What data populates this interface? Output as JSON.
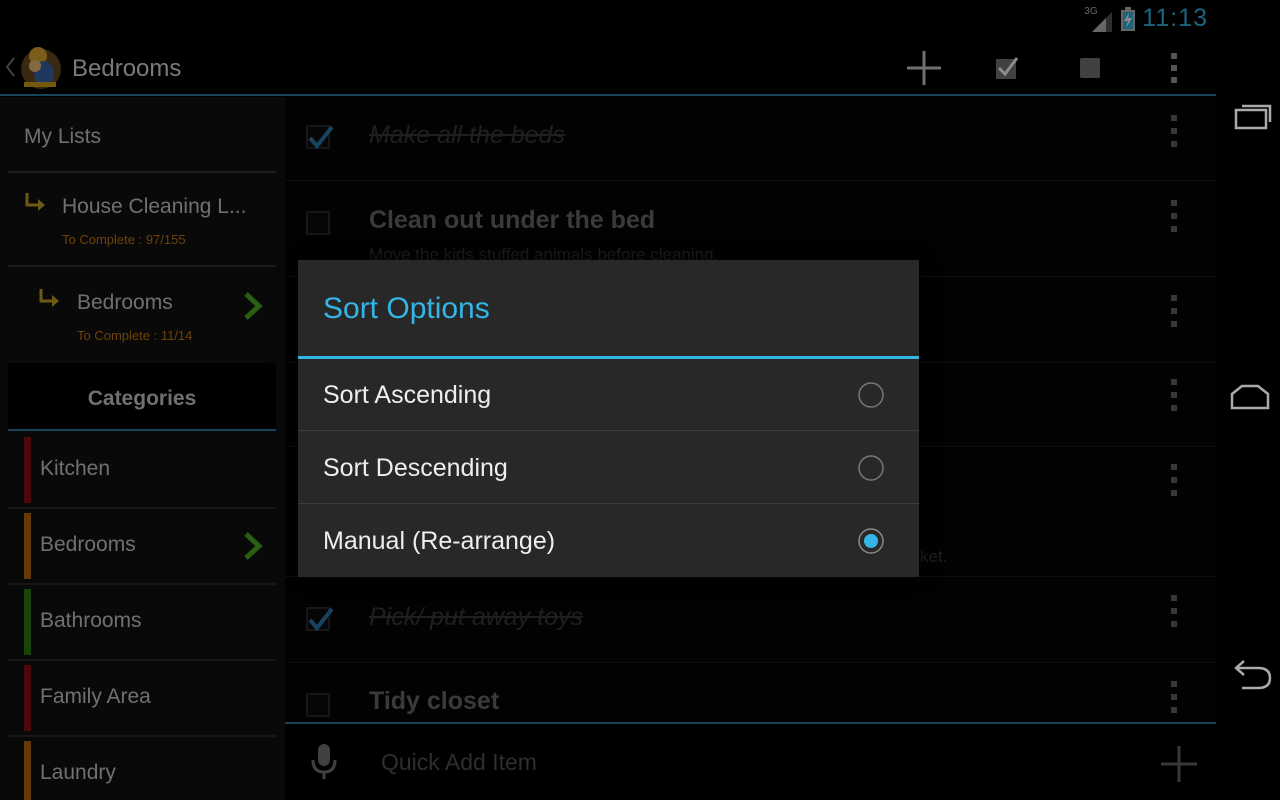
{
  "status_bar": {
    "network": "3G",
    "time": "11:13",
    "accent": "#33b5e5"
  },
  "action_bar": {
    "title": "Bedrooms",
    "actions": [
      "add-icon",
      "check-all-icon",
      "uncheck-all-icon",
      "overflow-menu-icon"
    ]
  },
  "sidebar": {
    "my_lists_label": "My Lists",
    "lists": [
      {
        "name": "House Cleaning L...",
        "progress": "To Complete : 97/155",
        "active": false
      },
      {
        "name": "Bedrooms",
        "progress": "To Complete : 11/14",
        "active": true
      }
    ],
    "categories_label": "Categories",
    "categories": [
      {
        "label": "Kitchen",
        "color": "#8b1015",
        "active": false
      },
      {
        "label": "Bedrooms",
        "color": "#b8670d",
        "active": true
      },
      {
        "label": "Bathrooms",
        "color": "#2f7d12",
        "active": false
      },
      {
        "label": "Family Area",
        "color": "#8b1015",
        "active": false
      },
      {
        "label": "Laundry",
        "color": "#b8670d",
        "active": false
      }
    ]
  },
  "items": [
    {
      "title": "Make all the beds",
      "note": "",
      "checked": true
    },
    {
      "title": "Clean out under the bed",
      "note": "Move the kids stuffed animals before cleaning.",
      "checked": false
    },
    {
      "title": "",
      "note": "",
      "checked": false
    },
    {
      "title": "",
      "note": "",
      "checked": false
    },
    {
      "title": "",
      "note": "ket.",
      "checked": false
    },
    {
      "title": "Pick/ put away toys",
      "note": "",
      "checked": true
    },
    {
      "title": "Tidy closet",
      "note": "",
      "checked": false
    }
  ],
  "quick_add": {
    "placeholder": "Quick Add Item"
  },
  "dialog": {
    "title": "Sort Options",
    "options": [
      {
        "label": "Sort Ascending",
        "selected": false
      },
      {
        "label": "Sort Descending",
        "selected": false
      },
      {
        "label": "Manual (Re-arrange)",
        "selected": true
      }
    ]
  },
  "nav_bar": [
    "recent-apps-icon",
    "home-icon",
    "back-icon"
  ]
}
